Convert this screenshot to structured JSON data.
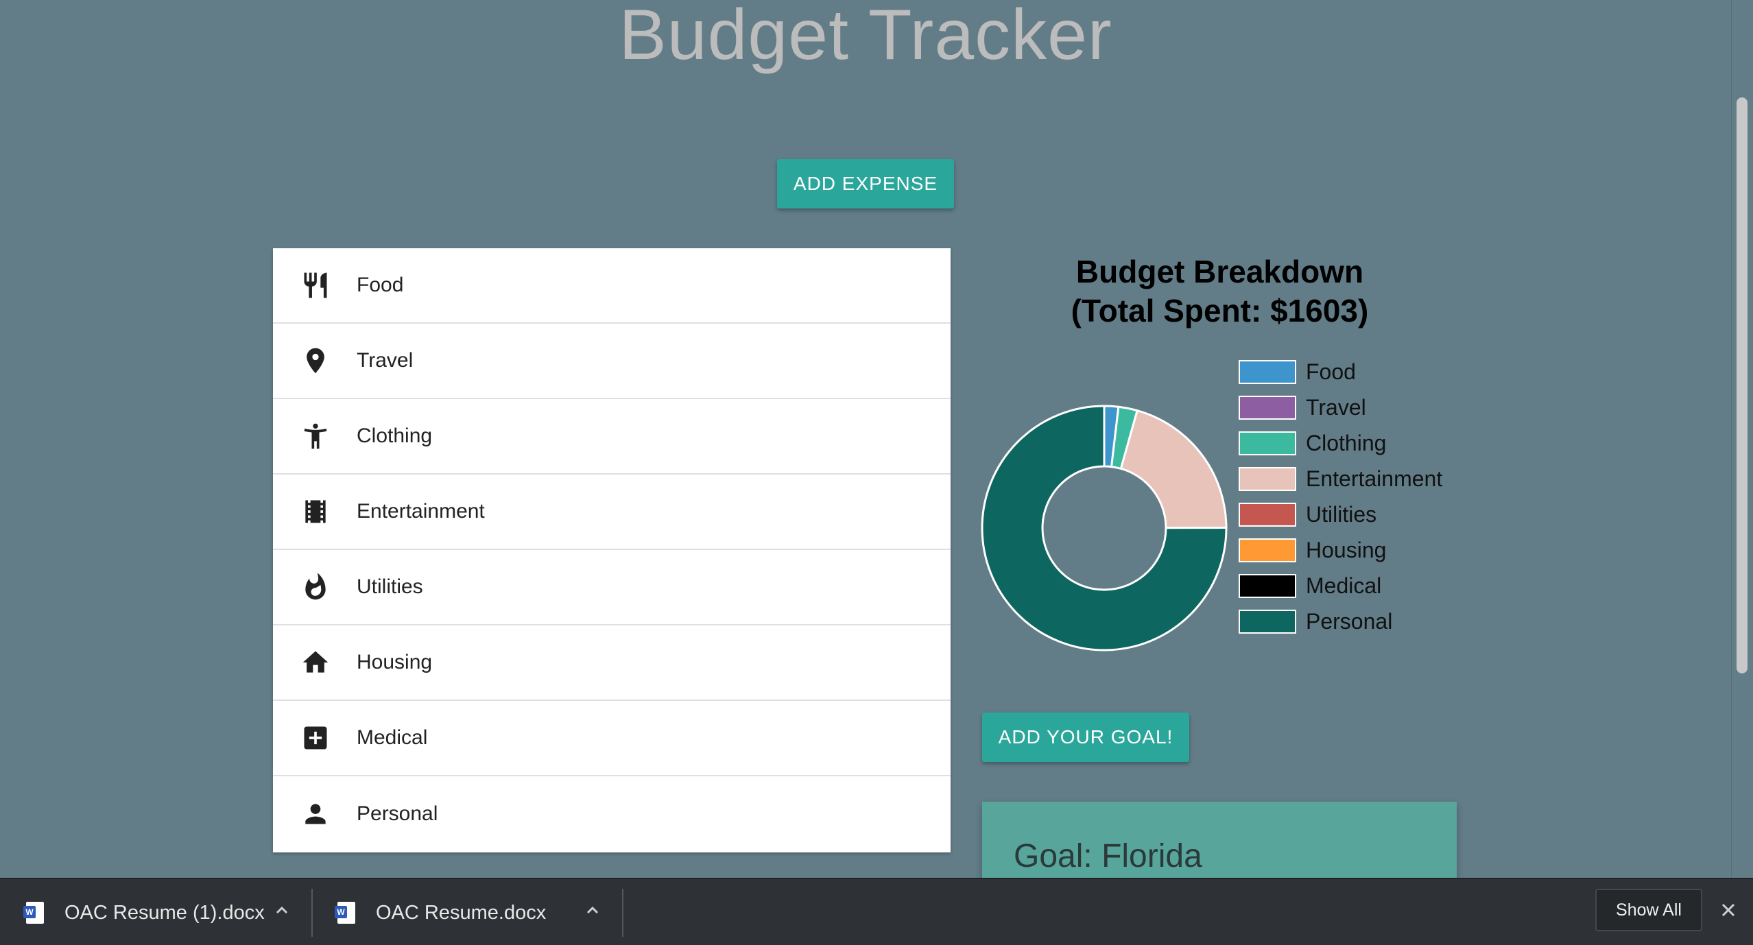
{
  "header": {
    "title": "Budget Tracker"
  },
  "buttons": {
    "add_expense": "ADD EXPENSE",
    "add_goal": "ADD YOUR GOAL!"
  },
  "categories": [
    {
      "label": "Food",
      "icon": "fork-knife-icon"
    },
    {
      "label": "Travel",
      "icon": "location-pin-icon"
    },
    {
      "label": "Clothing",
      "icon": "person-standing-icon"
    },
    {
      "label": "Entertainment",
      "icon": "film-icon"
    },
    {
      "label": "Utilities",
      "icon": "flame-icon"
    },
    {
      "label": "Housing",
      "icon": "home-icon"
    },
    {
      "label": "Medical",
      "icon": "medical-cross-icon"
    },
    {
      "label": "Personal",
      "icon": "person-icon"
    }
  ],
  "chart": {
    "title_line1": "Budget Breakdown",
    "title_line2": "(Total Spent: $1603)"
  },
  "chart_data": {
    "type": "pie",
    "title": "Budget Breakdown (Total Spent: $1603)",
    "categories": [
      "Food",
      "Travel",
      "Clothing",
      "Entertainment",
      "Utilities",
      "Housing",
      "Medical",
      "Personal"
    ],
    "values": [
      30,
      0,
      40,
      330,
      0,
      0,
      0,
      1203
    ],
    "colors": [
      "#3e95cd",
      "#8e5ea2",
      "#3cba9f",
      "#e8c3b9",
      "#c45850",
      "#ff9933",
      "#000000",
      "#0d6660"
    ],
    "legend_position": "right",
    "donut": true
  },
  "goal": {
    "text": "Goal: Florida"
  },
  "downloads": {
    "items": [
      {
        "name": "OAC Resume (1).docx"
      },
      {
        "name": "OAC Resume.docx"
      }
    ],
    "show_all": "Show All"
  }
}
